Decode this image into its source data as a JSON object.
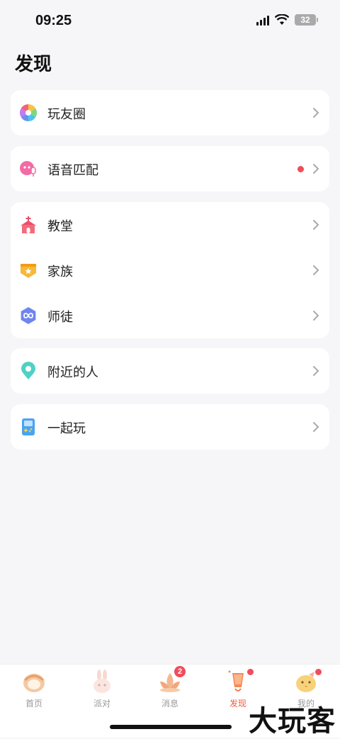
{
  "status": {
    "time": "09:25",
    "battery": "32"
  },
  "page": {
    "title": "发现"
  },
  "sections": [
    {
      "items": [
        {
          "label": "玩友圈",
          "icon": "pinwheel-icon",
          "dot": false
        }
      ]
    },
    {
      "items": [
        {
          "label": "语音匹配",
          "icon": "voice-match-icon",
          "dot": true
        }
      ]
    },
    {
      "items": [
        {
          "label": "教堂",
          "icon": "church-icon",
          "dot": false
        },
        {
          "label": "家族",
          "icon": "family-icon",
          "dot": false
        },
        {
          "label": "师徒",
          "icon": "mentor-icon",
          "dot": false
        }
      ]
    },
    {
      "items": [
        {
          "label": "附近的人",
          "icon": "location-pin-icon",
          "dot": false
        }
      ]
    },
    {
      "items": [
        {
          "label": "一起玩",
          "icon": "game-console-icon",
          "dot": false
        }
      ]
    }
  ],
  "tabbar": [
    {
      "label": "首页",
      "icon": "home-icon",
      "active": false
    },
    {
      "label": "派对",
      "icon": "party-rabbit-icon",
      "active": false
    },
    {
      "label": "消息",
      "icon": "message-lotus-icon",
      "active": false,
      "badge": "2"
    },
    {
      "label": "发现",
      "icon": "discover-lantern-icon",
      "active": true,
      "dot": true
    },
    {
      "label": "我的",
      "icon": "profile-chick-icon",
      "active": false,
      "dot": true
    }
  ],
  "watermark": "大玩客",
  "colors": {
    "accent": "#f15a3d",
    "badge": "#ee4d5b",
    "background": "#f6f6f8"
  }
}
